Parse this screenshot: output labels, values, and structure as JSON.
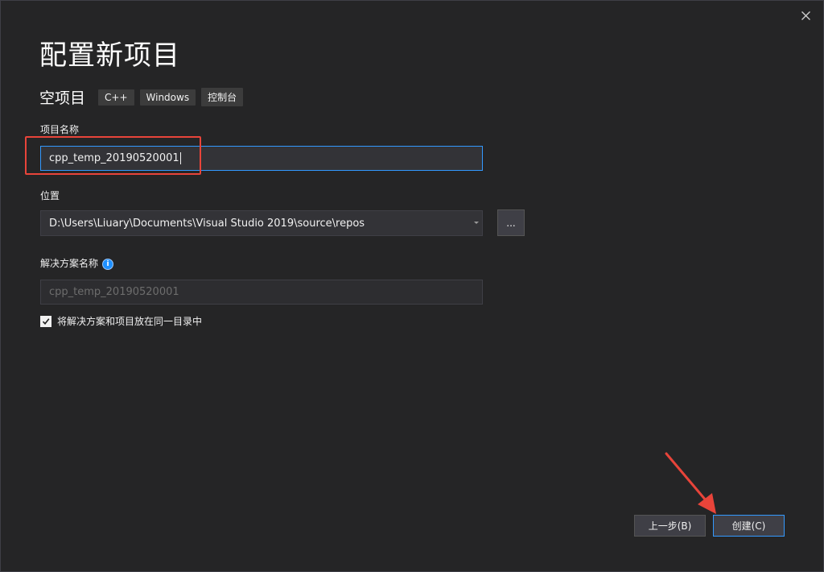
{
  "dialog": {
    "title": "配置新项目",
    "subtitle": "空项目",
    "tags": [
      "C++",
      "Windows",
      "控制台"
    ]
  },
  "project_name": {
    "label": "项目名称",
    "value": "cpp_temp_20190520001"
  },
  "location": {
    "label": "位置",
    "value": "D:\\Users\\Liuary\\Documents\\Visual Studio 2019\\source\\repos",
    "browse_label": "..."
  },
  "solution_name": {
    "label": "解决方案名称",
    "value": "cpp_temp_20190520001",
    "info_glyph": "i"
  },
  "same_dir_option": {
    "label": "将解决方案和项目放在同一目录中",
    "checked": true
  },
  "buttons": {
    "back_label": "上一步(B)",
    "create_label": "创建(C)"
  },
  "colors": {
    "background": "#252526",
    "accent": "#3399ff",
    "annotation": "#e8443a"
  },
  "icons": {
    "close": "close-icon",
    "dropdown": "chevron-down-icon",
    "info": "info-icon",
    "check": "checkmark-icon"
  }
}
